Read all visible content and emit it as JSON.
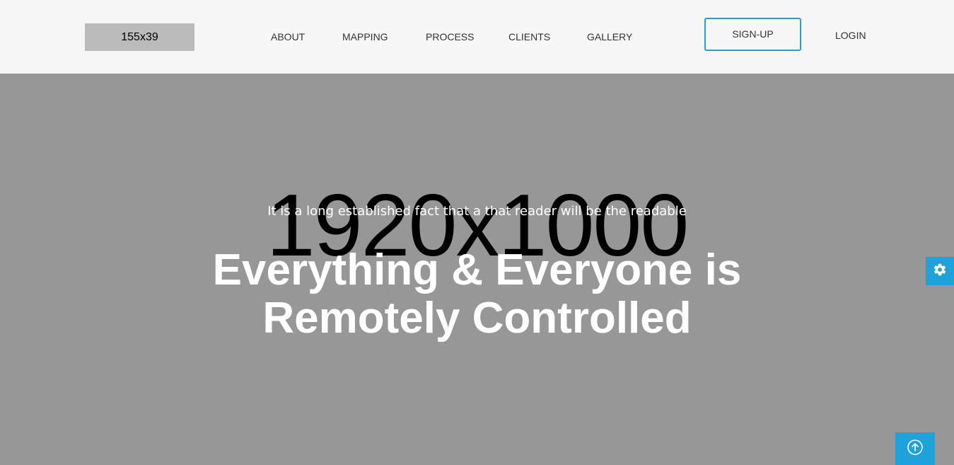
{
  "header": {
    "logo_text": "155x39",
    "nav": [
      {
        "label": "ABOUT"
      },
      {
        "label": "MAPPING"
      },
      {
        "label": "PROCESS"
      },
      {
        "label": "CLIENTS"
      },
      {
        "label": "GALLERY"
      }
    ],
    "signup_label": "SIGN-UP",
    "login_label": "LOGIN"
  },
  "hero": {
    "placeholder_size": "1920x1000",
    "subtitle": "It is a long established fact that a that reader will be the readable",
    "title_line1": "Everything & Everyone is",
    "title_line2": "Remotely Controlled"
  },
  "colors": {
    "accent": "#1fa2dc",
    "header_bg": "#f7f7f7",
    "hero_bg": "#979797"
  },
  "icons": {
    "settings": "gear-icon",
    "scroll_top": "arrow-up-circle-icon"
  }
}
